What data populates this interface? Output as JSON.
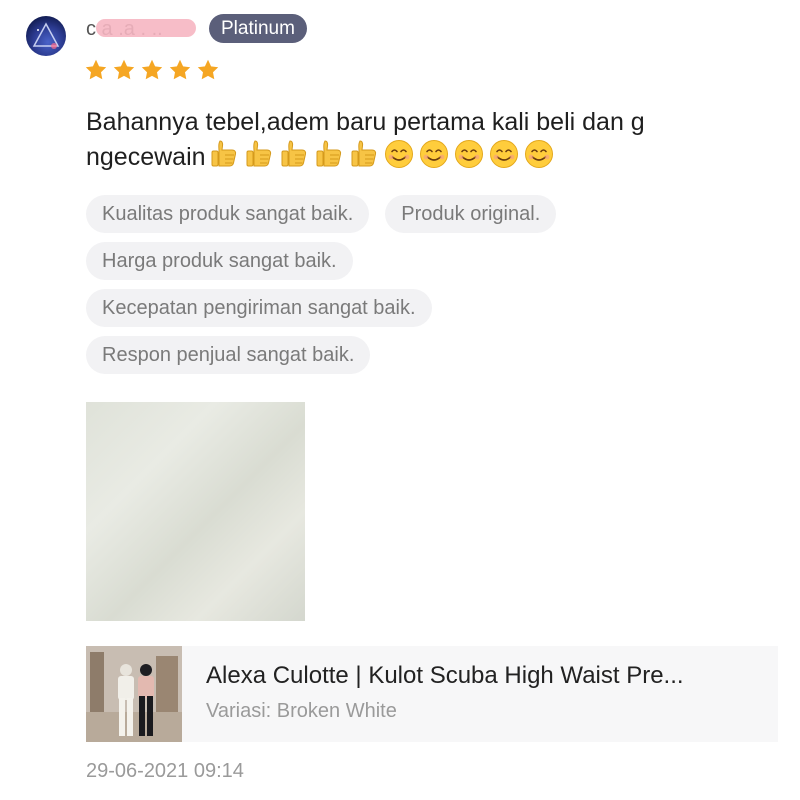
{
  "reviewer": {
    "name": "c a .a . ..",
    "badge": "Platinum"
  },
  "rating": {
    "stars": 5,
    "max": 5,
    "star_color": "#f5a623"
  },
  "review": {
    "text": "Bahannya tebel,adem baru pertama kali beli dan g\nngecewain",
    "emojis": [
      "thumbs-up",
      "thumbs-up",
      "thumbs-up",
      "thumbs-up",
      "thumbs-up",
      "smiling-face",
      "smiling-face",
      "smiling-face",
      "smiling-face",
      "smiling-face"
    ]
  },
  "tags": [
    [
      "Kualitas produk sangat baik.",
      "Produk original."
    ],
    [
      "Harga produk sangat baik."
    ],
    [
      "Kecepatan pengiriman sangat baik."
    ],
    [
      "Respon penjual sangat baik."
    ]
  ],
  "product": {
    "name": "Alexa Culotte | Kulot Scuba High Waist Pre...",
    "variant": "Variasi: Broken White"
  },
  "timestamp": "29-06-2021 09:14",
  "colors": {
    "badge_bg": "#5b5f7a",
    "tag_bg": "#f2f2f4",
    "tag_text": "#7a7a7a"
  }
}
